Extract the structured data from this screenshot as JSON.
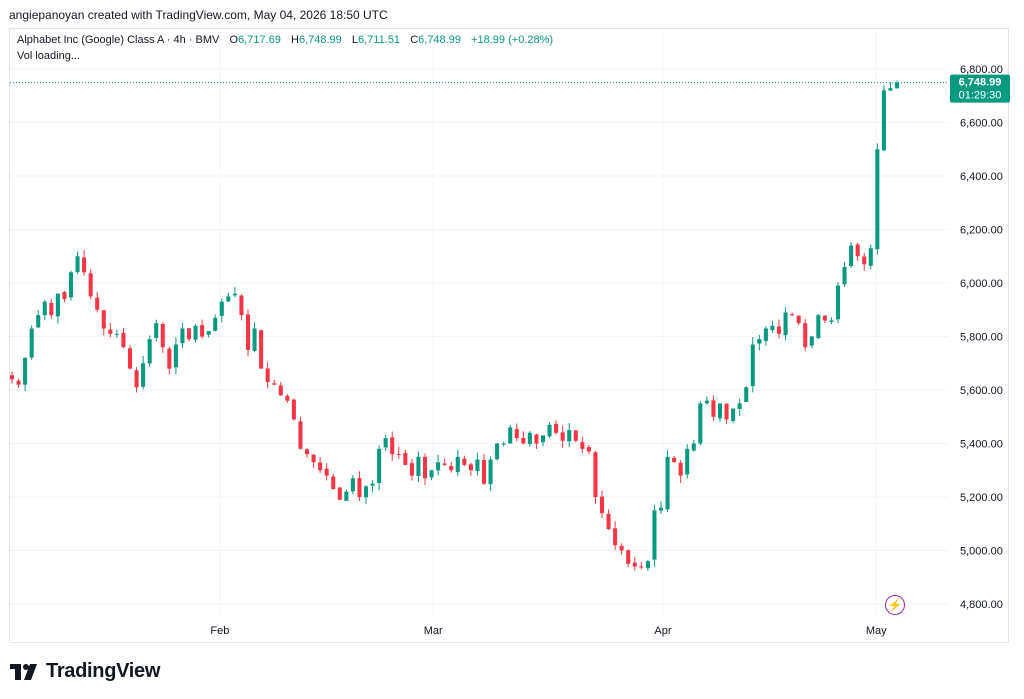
{
  "header": {
    "attribution": "angiepanoyan created with TradingView.com, May 04, 2026 18:50 UTC"
  },
  "legend": {
    "symbol": "Alphabet Inc (Google) Class A · 4h · BMV",
    "open_label": "O",
    "open": "6,717.69",
    "high_label": "H",
    "high": "6,748.99",
    "low_label": "L",
    "low": "6,711.51",
    "close_label": "C",
    "close": "6,748.99",
    "change": "+18.99 (+0.28%)",
    "volume_status": "Vol loading..."
  },
  "price_tag": {
    "price": "6,748.99",
    "countdown": "01:29:30"
  },
  "footer": {
    "brand": "TradingView"
  },
  "colors": {
    "up": "#089981",
    "down": "#f23645",
    "grid": "#f0f3fa",
    "text": "#131722",
    "event": "#9c27b0"
  },
  "chart_data": {
    "type": "candlestick",
    "y_ticks": [
      "4,800.00",
      "5,000.00",
      "5,200.00",
      "5,400.00",
      "5,600.00",
      "5,800.00",
      "6,000.00",
      "6,200.00",
      "6,400.00",
      "6,600.00",
      "6,800.00"
    ],
    "ylim": [
      4800,
      6800
    ],
    "x_ticks": [
      "Feb",
      "Mar",
      "Apr",
      "May"
    ],
    "last_price": 6748.99,
    "grid": true,
    "closes": [
      5640,
      5620,
      5720,
      5830,
      5880,
      5930,
      5880,
      5960,
      5940,
      6040,
      6100,
      6040,
      5950,
      5900,
      5830,
      5810,
      5810,
      5760,
      5680,
      5610,
      5700,
      5790,
      5850,
      5760,
      5680,
      5770,
      5830,
      5790,
      5840,
      5800,
      5820,
      5870,
      5930,
      5950,
      5960,
      5880,
      5750,
      5830,
      5680,
      5630,
      5620,
      5580,
      5560,
      5490,
      5380,
      5360,
      5330,
      5300,
      5280,
      5230,
      5190,
      5220,
      5270,
      5200,
      5240,
      5250,
      5380,
      5420,
      5360,
      5360,
      5320,
      5280,
      5350,
      5270,
      5300,
      5330,
      5320,
      5300,
      5350,
      5320,
      5300,
      5340,
      5250,
      5340,
      5400,
      5400,
      5460,
      5420,
      5400,
      5440,
      5400,
      5430,
      5470,
      5440,
      5410,
      5450,
      5410,
      5380,
      5370,
      5200,
      5140,
      5080,
      5020,
      5000,
      4950,
      4940,
      4940,
      4960,
      5150,
      5160,
      5350,
      5330,
      5280,
      5380,
      5400,
      5550,
      5560,
      5500,
      5550,
      5490,
      5530,
      5550,
      5610,
      5770,
      5790,
      5830,
      5840,
      5810,
      5890,
      5880,
      5850,
      5760,
      5800,
      5880,
      5860,
      5860,
      5990,
      6060,
      6140,
      6100,
      6070,
      6130,
      6500,
      6720,
      6729,
      6749
    ]
  }
}
